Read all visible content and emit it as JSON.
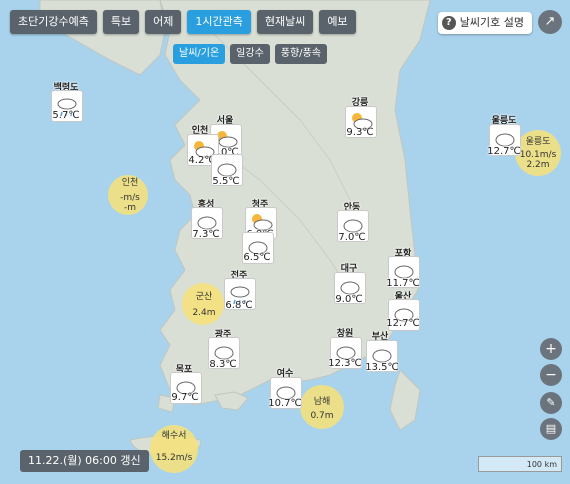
{
  "tabs": {
    "short_rain": "초단기강수예측",
    "warning": "특보",
    "yesterday": "어제",
    "hourly": "1시간관측",
    "current": "현재날씨",
    "forecast": "예보"
  },
  "subtabs": {
    "weather_temp": "날씨/기온",
    "precip": "일강수",
    "wind": "풍향/풍속"
  },
  "help_label": "날씨기호 설명",
  "update_label": "11.22.(월) 06:00 갱신",
  "scale_label": "100 km",
  "colors": {
    "active": "#2a9fe0",
    "button": "#5a636b",
    "sea": "#a9d3ec",
    "land": "#d9dfd5",
    "wave": "#f7e278"
  },
  "stations": [
    {
      "name": "백령도",
      "temp": "5.7℃",
      "icon": "rain-cloud-icon"
    },
    {
      "name": "서울",
      "temp": "4.0℃",
      "icon": "partly-cloudy-icon"
    },
    {
      "name": "인천",
      "temp": "4.2℃",
      "icon": "partly-cloudy-icon"
    },
    {
      "name": "",
      "temp": "5.5℃",
      "icon": "cloud-icon"
    },
    {
      "name": "강릉",
      "temp": "9.3℃",
      "icon": "partly-cloudy-icon"
    },
    {
      "name": "울릉도",
      "temp": "12.7℃",
      "icon": "cloud-icon"
    },
    {
      "name": "홍성",
      "temp": "7.3℃",
      "icon": "cloud-icon"
    },
    {
      "name": "청주",
      "temp": "6.9℃",
      "icon": "partly-cloudy-icon"
    },
    {
      "name": "",
      "temp": "6.5℃",
      "icon": "cloud-icon"
    },
    {
      "name": "안동",
      "temp": "7.0℃",
      "icon": "cloud-icon"
    },
    {
      "name": "전주",
      "temp": "6.8℃",
      "icon": "rain-cloud-icon"
    },
    {
      "name": "대구",
      "temp": "9.0℃",
      "icon": "cloud-icon"
    },
    {
      "name": "포항",
      "temp": "11.7℃",
      "icon": "cloud-icon"
    },
    {
      "name": "울산",
      "temp": "12.7℃",
      "icon": "cloud-icon"
    },
    {
      "name": "광주",
      "temp": "8.3℃",
      "icon": "cloud-icon"
    },
    {
      "name": "창원",
      "temp": "12.3℃",
      "icon": "cloud-icon"
    },
    {
      "name": "부산",
      "temp": "13.5℃",
      "icon": "cloud-icon"
    },
    {
      "name": "목포",
      "temp": "9.7℃",
      "icon": "cloud-icon"
    },
    {
      "name": "여수",
      "temp": "10.7℃",
      "icon": "cloud-icon"
    }
  ],
  "waves": [
    {
      "name": "인천",
      "speed": "-m/s",
      "height": "-m"
    },
    {
      "name": "울릉도",
      "speed": "10.1m/s",
      "height": "2.2m"
    },
    {
      "name": "군산",
      "speed": "",
      "height": "2.4m"
    },
    {
      "name": "남해",
      "speed": "",
      "height": "0.7m"
    },
    {
      "name": "해수서",
      "speed": "15.2m/s",
      "height": ""
    }
  ]
}
